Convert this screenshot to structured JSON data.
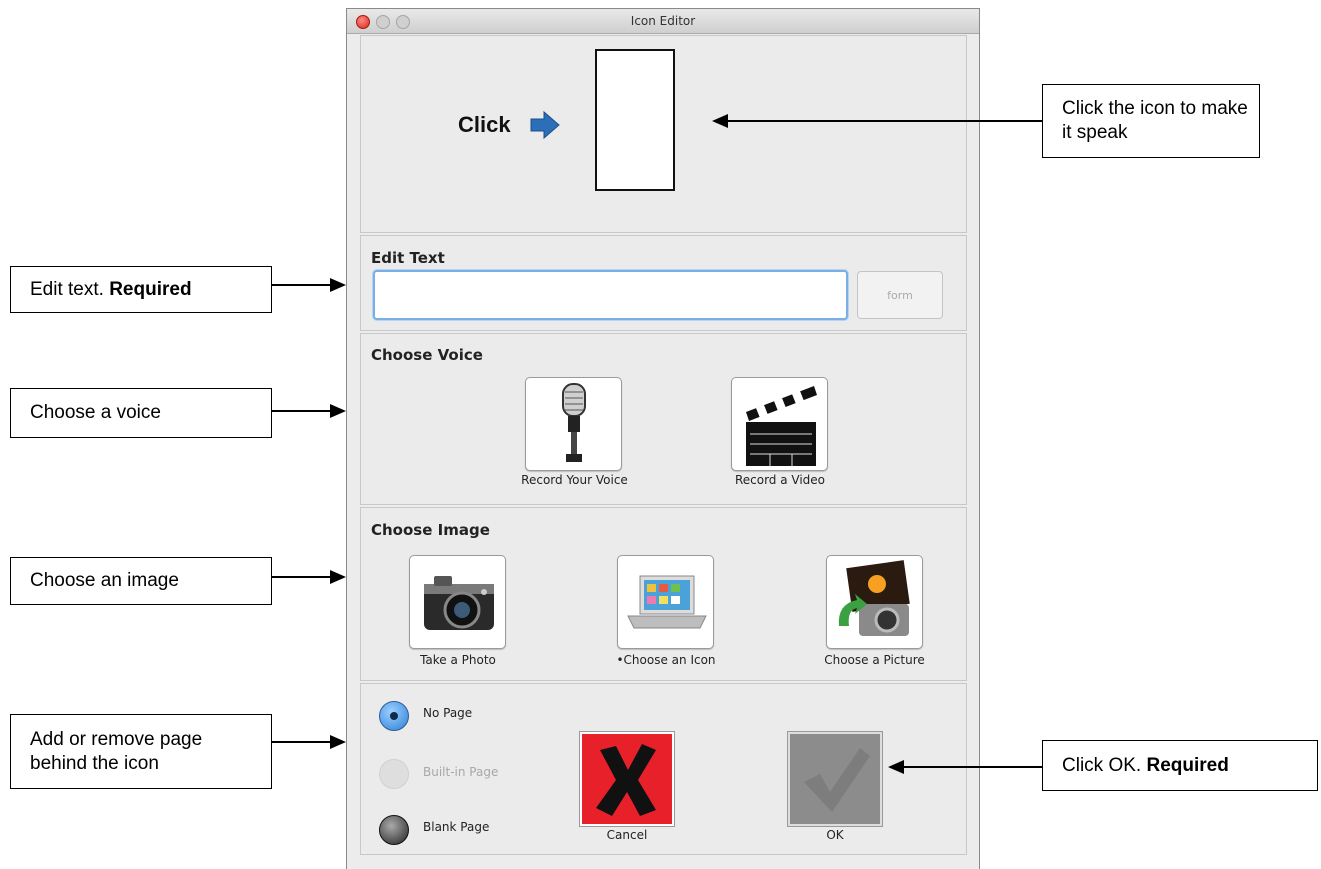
{
  "window": {
    "title": "Icon Editor"
  },
  "preview": {
    "click_label": "Click"
  },
  "edit_text": {
    "header": "Edit Text",
    "value": "",
    "form_button": "form"
  },
  "voice": {
    "header": "Choose Voice",
    "options": [
      {
        "label": "Record Your Voice",
        "icon": "microphone-icon"
      },
      {
        "label": "Record a Video",
        "icon": "clapperboard-icon"
      }
    ]
  },
  "image": {
    "header": "Choose Image",
    "options": [
      {
        "label": "Take a Photo",
        "icon": "camera-icon"
      },
      {
        "label": "•Choose an Icon",
        "icon": "laptop-icon"
      },
      {
        "label": "Choose a Picture",
        "icon": "picture-icon"
      }
    ]
  },
  "page_options": [
    {
      "label": "No Page",
      "selected": true,
      "enabled": true
    },
    {
      "label": "Built-in Page",
      "selected": false,
      "enabled": false
    },
    {
      "label": "Blank Page",
      "selected": false,
      "enabled": true
    }
  ],
  "actions": {
    "cancel": "Cancel",
    "ok": "OK"
  },
  "annotations": {
    "speak": "Click the icon to make it speak",
    "edit_text_pre": "Edit text.",
    "edit_text_req": "Required",
    "voice": "Choose a voice",
    "image": "Choose an image",
    "page": "Add or remove page behind the icon",
    "ok_pre": "Click OK.",
    "ok_req": "Required"
  },
  "colors": {
    "cancel_bg": "#e8202a",
    "ok_bg": "#8c8c8c",
    "arrow_blue": "#2a6fb8",
    "focus_ring": "#7aaee6"
  }
}
